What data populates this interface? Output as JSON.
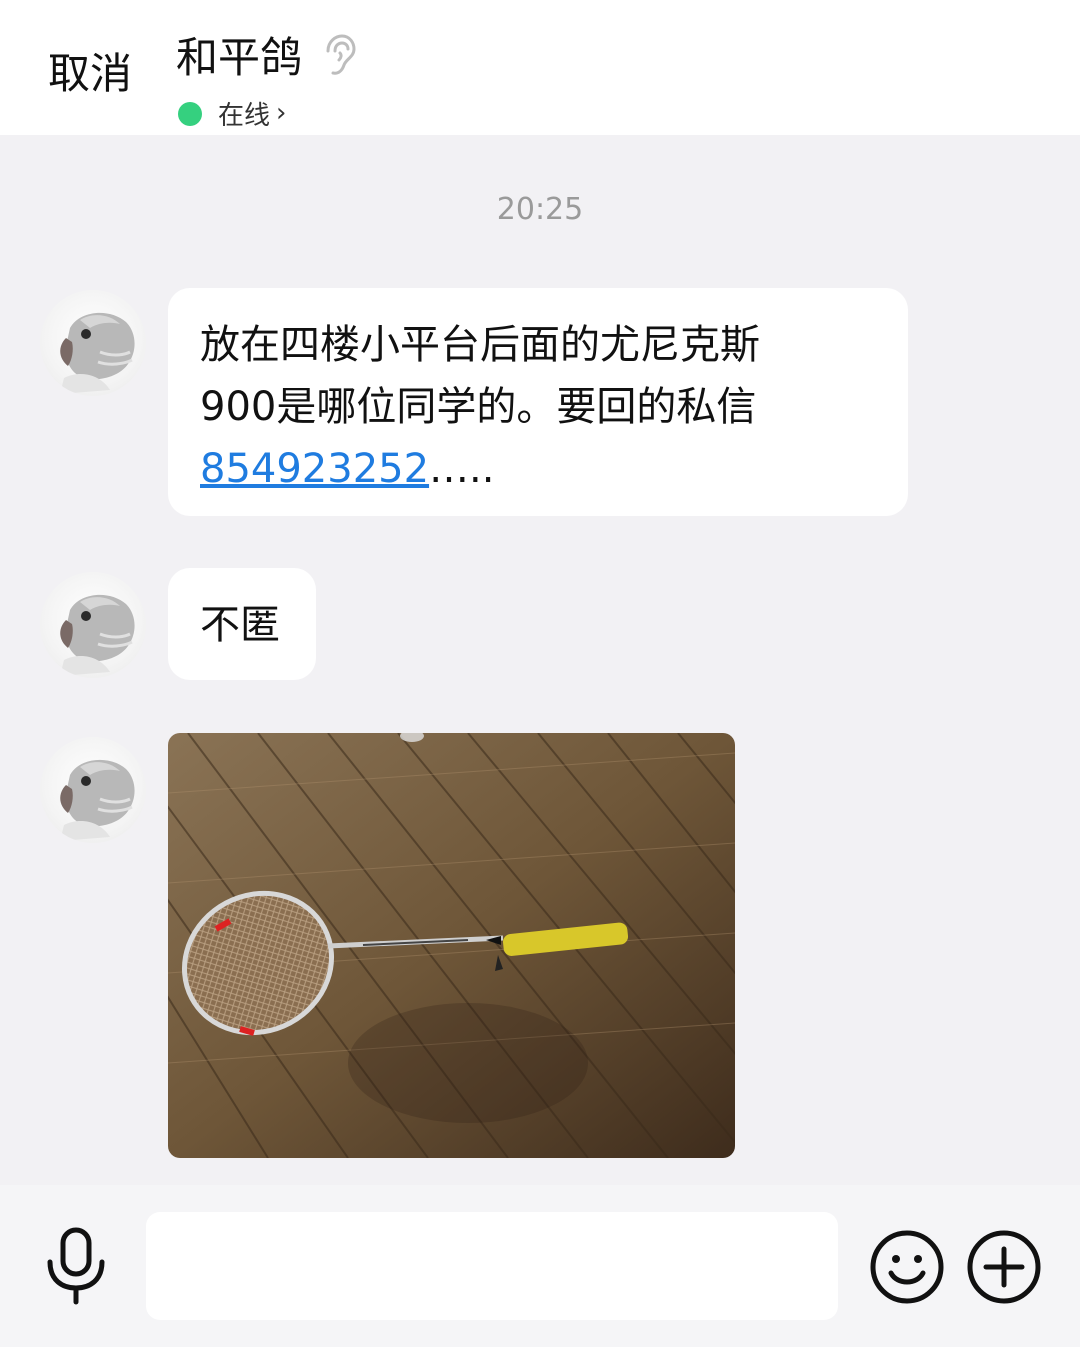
{
  "header": {
    "cancel_label": "取消",
    "title": "和平鸽",
    "status": "在线",
    "status_color": "#35d07f"
  },
  "chat": {
    "timestamp": "20:25",
    "messages": [
      {
        "line1": "放在四楼小平台后面的尤尼克斯",
        "line2": "900是哪位同学的。要回的私信",
        "link": "854923252",
        "link_suffix": "….."
      },
      {
        "text": "不匿"
      },
      {
        "image": "badminton-racket-photo"
      }
    ]
  },
  "composer": {
    "placeholder": "",
    "icons": [
      "mic-icon",
      "emoji-icon",
      "plus-icon"
    ]
  },
  "colors": {
    "link": "#1f7ce0",
    "background": "#f2f1f4",
    "bubble": "#ffffff"
  }
}
